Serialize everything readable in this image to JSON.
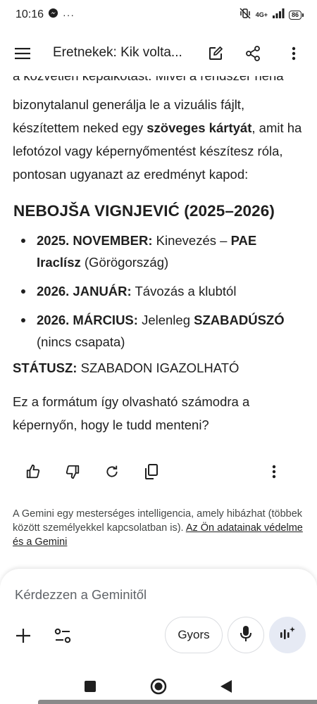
{
  "status_bar": {
    "time": "10:16",
    "more": "···",
    "network": "4G+",
    "battery": "86"
  },
  "app_bar": {
    "title": "Eretnekek: Kik volta..."
  },
  "message": {
    "clipped_line": "a közvetlen képalkotást. Mivel a rendszer néha",
    "intro_1": "bizonytalanul generálja le a vizuális fájlt, készítettem neked egy ",
    "intro_bold": "szöveges kártyát",
    "intro_2": ", amit ha lefotózol vagy képernyőmentést készítesz róla, pontosan ugyanazt az eredményt kapod:",
    "heading": "NEBOJŠA VIGNJEVIĆ (2025–2026)",
    "timeline": [
      {
        "date": "2025. NOVEMBER:",
        "text": " Kinevezés – ",
        "bold": "PAE Iraclísz",
        "after": " (Görögország)"
      },
      {
        "date": "2026. JANUÁR:",
        "text": " Távozás a klubtól",
        "bold": "",
        "after": ""
      },
      {
        "date": "2026. MÁRCIUS:",
        "text": " Jelenleg ",
        "bold": "SZABADÚSZÓ",
        "after": " (nincs csapata)"
      }
    ],
    "status_label": "STÁTUSZ:",
    "status_value": " SZABADON IGAZOLHATÓ",
    "question": "Ez a formátum így olvasható számodra a képernyőn, hogy le tudd menteni?"
  },
  "disclaimer": {
    "text": "A Gemini egy mesterséges intelligencia, amely hibázhat (többek között személyekkel kapcsolatban is). ",
    "link": "Az Ön adatainak védelme és a Gemini"
  },
  "composer": {
    "placeholder": "Kérdezzen a Geminitől",
    "mode_label": "Gyors"
  },
  "colors": {
    "text": "#1f1f1f",
    "muted": "#444746",
    "live_chip_bg": "#e6eaf4"
  }
}
